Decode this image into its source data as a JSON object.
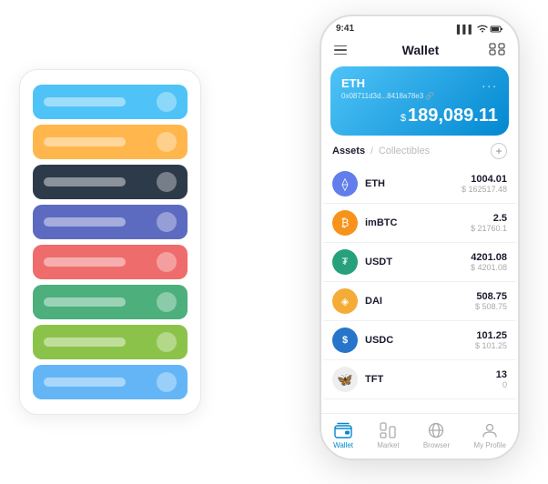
{
  "scene": {
    "cards": [
      {
        "color": "row-blue",
        "label": "card-1"
      },
      {
        "color": "row-orange",
        "label": "card-2"
      },
      {
        "color": "row-dark",
        "label": "card-3"
      },
      {
        "color": "row-purple",
        "label": "card-4"
      },
      {
        "color": "row-red",
        "label": "card-5"
      },
      {
        "color": "row-green",
        "label": "card-6"
      },
      {
        "color": "row-lightgreen",
        "label": "card-7"
      },
      {
        "color": "row-skyblue",
        "label": "card-8"
      }
    ]
  },
  "phone": {
    "status": {
      "time": "9:41",
      "signal": "▌▌▌",
      "wifi": "WiFi",
      "battery": "■"
    },
    "header": {
      "title": "Wallet",
      "menu_icon": "≡",
      "expand_icon": "⇔"
    },
    "eth_card": {
      "name": "ETH",
      "address": "0x08711d3d...8418a78e3  🔗",
      "dots": "...",
      "currency_symbol": "$",
      "amount": "189,089.11"
    },
    "assets_header": {
      "tab_active": "Assets",
      "slash": "/",
      "tab_inactive": "Collectibles",
      "add_icon": "+"
    },
    "assets": [
      {
        "name": "ETH",
        "icon": "⟠",
        "icon_bg": "#627EEA",
        "amount": "1004.01",
        "usd": "$ 162517.48"
      },
      {
        "name": "imBTC",
        "icon": "₿",
        "icon_bg": "#F7931A",
        "amount": "2.5",
        "usd": "$ 21760.1"
      },
      {
        "name": "USDT",
        "icon": "₮",
        "icon_bg": "#26A17B",
        "amount": "4201.08",
        "usd": "$ 4201.08"
      },
      {
        "name": "DAI",
        "icon": "◈",
        "icon_bg": "#F5AC37",
        "amount": "508.75",
        "usd": "$ 508.75"
      },
      {
        "name": "USDC",
        "icon": "$",
        "icon_bg": "#2775CA",
        "amount": "101.25",
        "usd": "$ 101.25"
      },
      {
        "name": "TFT",
        "icon": "🦋",
        "icon_bg": "#E8E8E8",
        "amount": "13",
        "usd": "0"
      }
    ],
    "nav": [
      {
        "label": "Wallet",
        "active": true
      },
      {
        "label": "Market",
        "active": false
      },
      {
        "label": "Browser",
        "active": false
      },
      {
        "label": "My Profile",
        "active": false
      }
    ]
  }
}
